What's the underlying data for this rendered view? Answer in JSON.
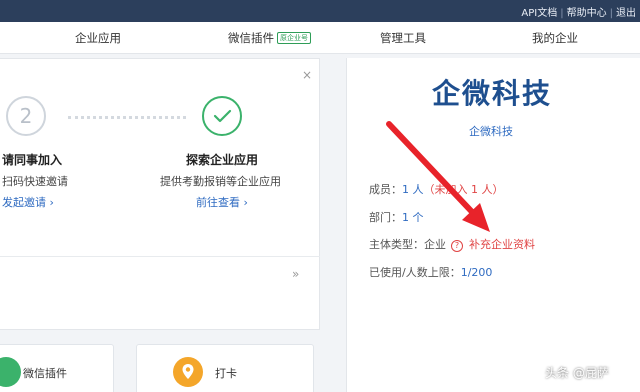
{
  "topbar": {
    "api": "API文档",
    "help": "帮助中心",
    "logout": "退出",
    "sep": "|"
  },
  "nav": {
    "apps": "企业应用",
    "wechat_plugin": "微信插件",
    "wechat_tag": "原企业号",
    "admin": "管理工具",
    "my_company": "我的企业"
  },
  "steps": {
    "step2_num": "2",
    "invite_title": "请同事加入",
    "invite_desc": "扫码快速邀请",
    "invite_link": "发起邀请 ›",
    "explore_title": "探索企业应用",
    "explore_desc": "提供考勤报销等企业应用",
    "explore_link": "前往查看 ›",
    "close": "×",
    "more": "»"
  },
  "company": {
    "name_big": "企微科技",
    "name_small": "企微科技",
    "members_label": "成员：",
    "members_value": "1 人",
    "members_unjoined": "（未加入 1 人）",
    "dept_label": "部门：",
    "dept_value": "1 个",
    "type_label": "主体类型：",
    "type_value": "企业",
    "type_help": "?",
    "supplement": "补充企业资料",
    "limit_label": "已使用/人数上限：",
    "limit_value": "1/200"
  },
  "cards": {
    "wechat": "微信插件",
    "checkin": "打卡"
  },
  "watermark": "头条 @屁萨",
  "colors": {
    "topbar": "#2c3f5c",
    "accent_blue": "#2f6bc1",
    "red": "#e04444",
    "green": "#3bb26b",
    "orange": "#f4a62a"
  }
}
